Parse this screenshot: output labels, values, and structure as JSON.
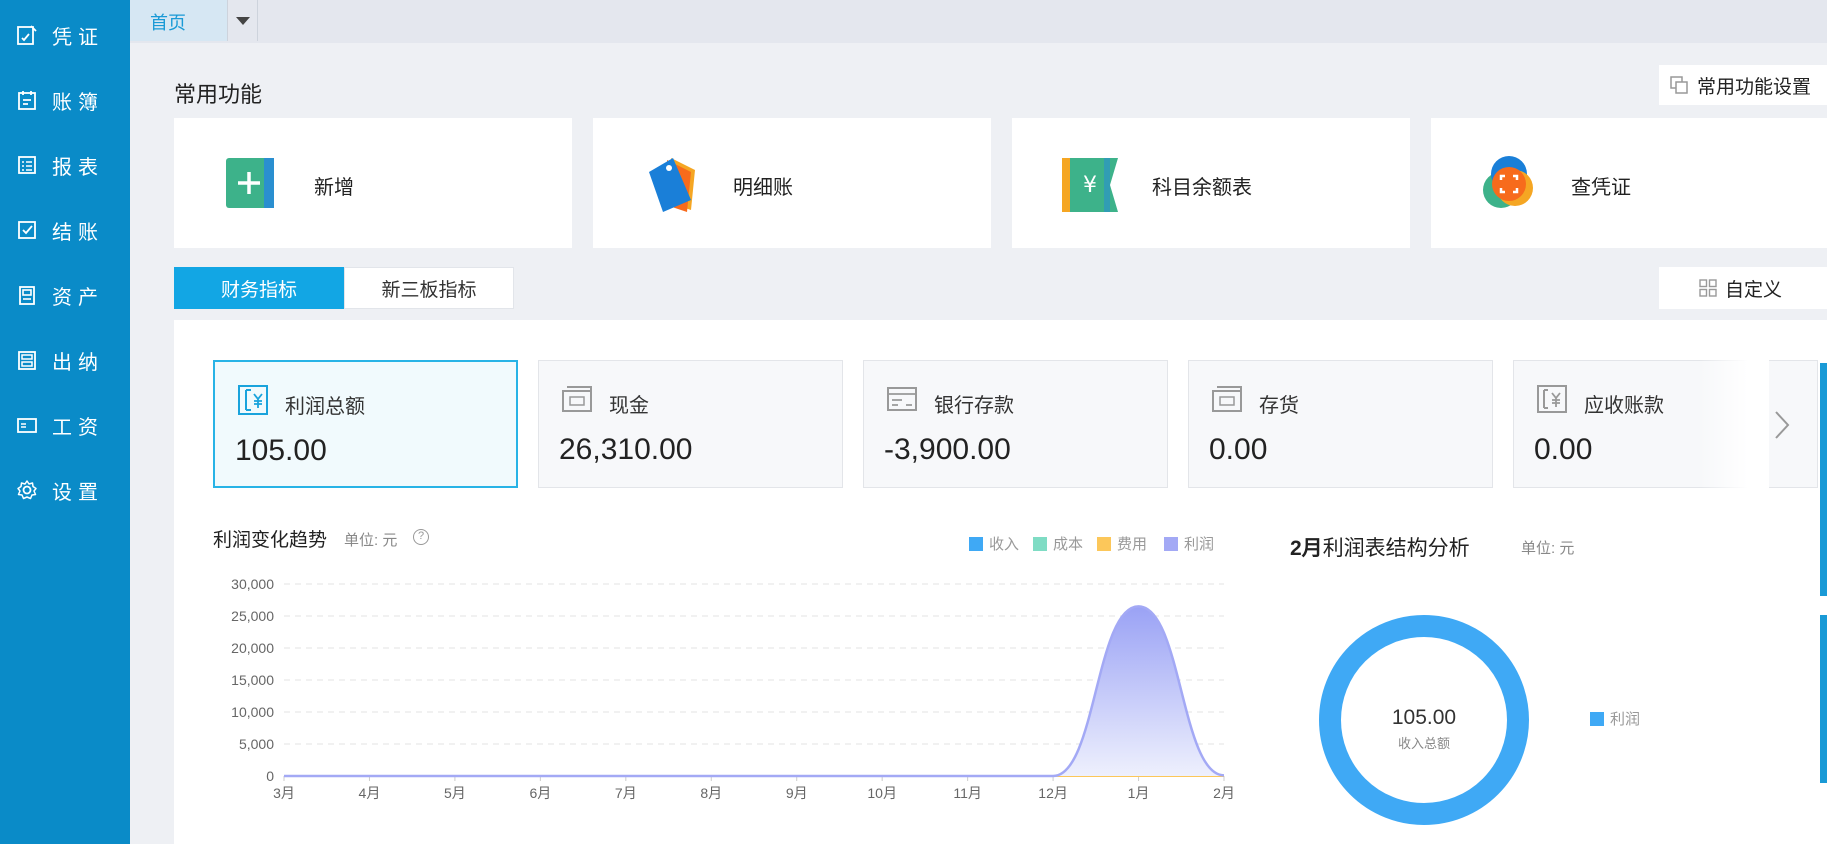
{
  "sidebar": {
    "items": [
      {
        "label": "凭证",
        "icon": "voucher-icon"
      },
      {
        "label": "账簿",
        "icon": "ledger-icon"
      },
      {
        "label": "报表",
        "icon": "report-icon"
      },
      {
        "label": "结账",
        "icon": "checkout-icon"
      },
      {
        "label": "资产",
        "icon": "asset-icon"
      },
      {
        "label": "出纳",
        "icon": "cashier-icon"
      },
      {
        "label": "工资",
        "icon": "salary-icon"
      },
      {
        "label": "设置",
        "icon": "gear-icon"
      }
    ]
  },
  "tabs": {
    "home": "首页"
  },
  "common": {
    "title": "常用功能",
    "settings_label": "常用功能设置",
    "items": [
      {
        "label": "新增",
        "icon": "add-icon"
      },
      {
        "label": "明细账",
        "icon": "tag-icon"
      },
      {
        "label": "科目余额表",
        "icon": "yuan-book-icon"
      },
      {
        "label": "查凭证",
        "icon": "scan-icon"
      }
    ]
  },
  "indicators": {
    "tabs": [
      "财务指标",
      "新三板指标"
    ],
    "active_tab": 0,
    "customize_label": "自定义",
    "metrics": [
      {
        "label": "利润总额",
        "value": "105.00",
        "icon": "profit-icon"
      },
      {
        "label": "现金",
        "value": "26,310.00",
        "icon": "cash-icon"
      },
      {
        "label": "银行存款",
        "value": "-3,900.00",
        "icon": "bank-icon"
      },
      {
        "label": "存货",
        "value": "0.00",
        "icon": "inventory-icon"
      },
      {
        "label": "应收账款",
        "value": "0.00",
        "icon": "receivable-icon"
      }
    ]
  },
  "trend": {
    "title": "利润变化趋势",
    "unit": "单位: 元",
    "legend": [
      "收入",
      "成本",
      "费用",
      "利润"
    ]
  },
  "structure": {
    "title_bold": "2月",
    "title_rest": "利润表结构分析",
    "unit": "单位: 元",
    "center_value": "105.00",
    "center_label": "收入总额",
    "legend": "利润"
  },
  "colors": {
    "sidebar": "#0a8bc8",
    "accent": "#12a6e4",
    "income": "#3fa9f5",
    "cost": "#7fdcc4",
    "expense": "#fcc75a",
    "profit": "#a3a9f5"
  },
  "chart_data": [
    {
      "type": "area",
      "title": "利润变化趋势",
      "ylabel": "单位: 元",
      "categories": [
        "3月",
        "4月",
        "5月",
        "6月",
        "7月",
        "8月",
        "9月",
        "10月",
        "11月",
        "12月",
        "1月",
        "2月"
      ],
      "ylim": [
        0,
        30000
      ],
      "yticks": [
        "0",
        "5,000",
        "10,000",
        "15,000",
        "20,000",
        "25,000",
        "30,000"
      ],
      "grid": true,
      "legend_position": "top-right",
      "series": [
        {
          "name": "收入",
          "values": [
            0,
            0,
            0,
            0,
            0,
            0,
            0,
            0,
            0,
            0,
            0,
            0
          ]
        },
        {
          "name": "成本",
          "values": [
            0,
            0,
            0,
            0,
            0,
            0,
            0,
            0,
            0,
            0,
            0,
            0
          ]
        },
        {
          "name": "费用",
          "values": [
            0,
            0,
            0,
            0,
            0,
            0,
            0,
            0,
            0,
            0,
            0,
            0
          ]
        },
        {
          "name": "利润",
          "values": [
            0,
            0,
            0,
            0,
            0,
            0,
            0,
            0,
            0,
            0,
            26500,
            105
          ]
        }
      ]
    },
    {
      "type": "pie",
      "title": "2月利润表结构分析",
      "slices": [
        {
          "name": "利润",
          "value": 105.0
        }
      ]
    }
  ]
}
